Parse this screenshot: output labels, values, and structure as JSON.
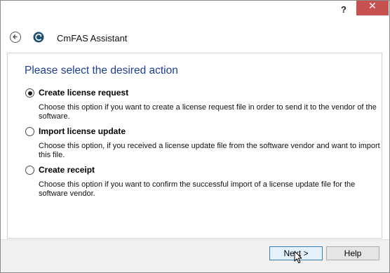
{
  "window": {
    "help_glyph": "?",
    "close_glyph": "✕"
  },
  "header": {
    "title": "CmFAS Assistant",
    "back_icon": "back-arrow-icon",
    "app_icon": "cmfas-logo-icon"
  },
  "main": {
    "heading": "Please select the desired action",
    "selected_option": 0,
    "options": [
      {
        "label": "Create license request",
        "description": "Choose this option if you want to create a license request file in order to send it to the vendor of the software."
      },
      {
        "label": "Import license update",
        "description": "Choose this option, if you received a license update file from the software vendor and want to import this file."
      },
      {
        "label": "Create receipt",
        "description": "Choose this option if you want to confirm the successful import of a license update file for the software vendor."
      }
    ]
  },
  "footer": {
    "next_label": "Next >",
    "help_label": "Help"
  },
  "colors": {
    "heading": "#1f3f8f",
    "close_button": "#c75050",
    "footer_bg": "#f0f0f0"
  }
}
